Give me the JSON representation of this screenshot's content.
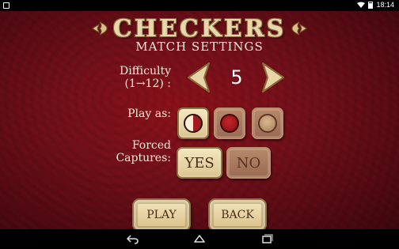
{
  "status_bar": {
    "time": "18:14"
  },
  "title": "CHECKERS",
  "subtitle": "MATCH SETTINGS",
  "difficulty": {
    "label_line1": "Difficulty",
    "label_line2": "(1→12) :",
    "value": "5"
  },
  "play_as": {
    "label": "Play as:",
    "options": [
      "mixed-piece-icon",
      "red-piece-icon",
      "white-piece-icon"
    ],
    "selected_index": 0
  },
  "forced_captures": {
    "label_line1": "Forced",
    "label_line2": "Captures:",
    "yes": "YES",
    "no": "NO",
    "selected": "YES"
  },
  "buttons": {
    "play": "PLAY",
    "back": "BACK"
  },
  "colors": {
    "background": "#74101a",
    "tile_selected": "#f4e6bf",
    "tile_unselected": "#a5735b",
    "title": "#e8d6ad"
  }
}
